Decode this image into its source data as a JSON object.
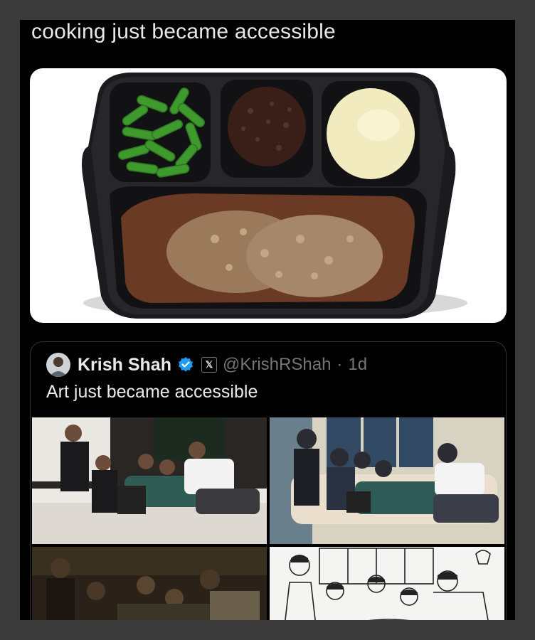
{
  "post": {
    "caption": "cooking just became accessible",
    "image_icon": "tv-dinner-tray-photo"
  },
  "quote": {
    "name": "Krish Shah",
    "handle": "@KrishRShah",
    "separator": "·",
    "time": "1d",
    "text": "Art just became accessible",
    "avatar_icon": "avatar-icon",
    "verified_icon": "verified-badge-icon",
    "x_icon_glyph": "𝕏",
    "images": [
      "group-photo-couch",
      "anime-style-couch-illustration",
      "dark-group-photo",
      "sketch-style-illustration"
    ]
  },
  "colors": {
    "background": "#3b3b3b",
    "panel": "#000000",
    "text": "#e7e9ea",
    "muted": "#71767b",
    "verified": "#1d9bf0"
  }
}
